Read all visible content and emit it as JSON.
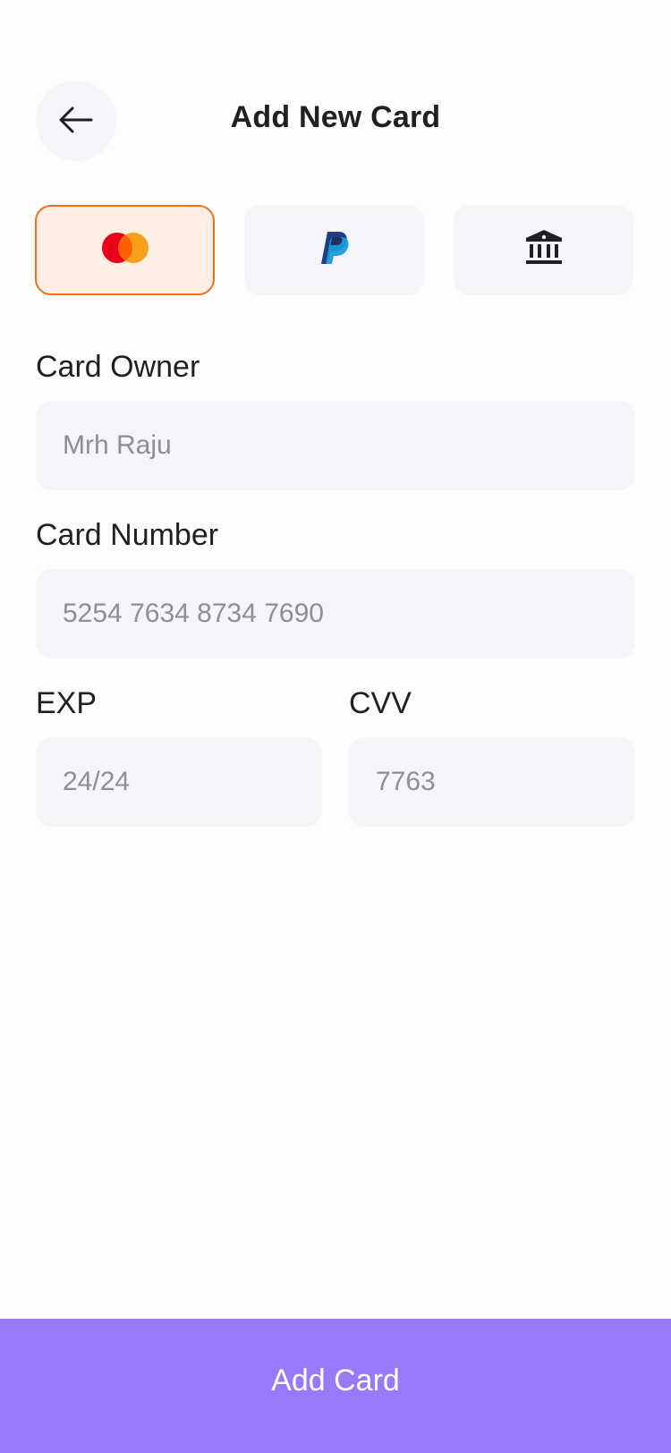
{
  "header": {
    "title": "Add New Card",
    "back_icon": "arrow-left-icon"
  },
  "payment_methods": [
    {
      "name": "Mastercard",
      "icon": "mastercard-icon",
      "selected": true
    },
    {
      "name": "PayPal",
      "icon": "paypal-icon",
      "selected": false
    },
    {
      "name": "Bank",
      "icon": "bank-icon",
      "selected": false
    }
  ],
  "form": {
    "owner": {
      "label": "Card Owner",
      "placeholder": "Mrh Raju",
      "value": ""
    },
    "number": {
      "label": "Card Number",
      "placeholder": "5254 7634 8734 7690",
      "value": ""
    },
    "exp": {
      "label": "EXP",
      "placeholder": "24/24",
      "value": ""
    },
    "cvv": {
      "label": "CVV",
      "placeholder": "7763",
      "value": ""
    }
  },
  "submit": {
    "label": "Add Card"
  },
  "colors": {
    "accent": "#9879fa",
    "selected_border": "#f06f1d",
    "selected_bg": "#ffeee4",
    "field_bg": "#f4f5f9",
    "mastercard_red": "#eb001b",
    "mastercard_orange": "#f79e1b",
    "paypal_dark": "#253b80",
    "paypal_light": "#179bd7"
  }
}
